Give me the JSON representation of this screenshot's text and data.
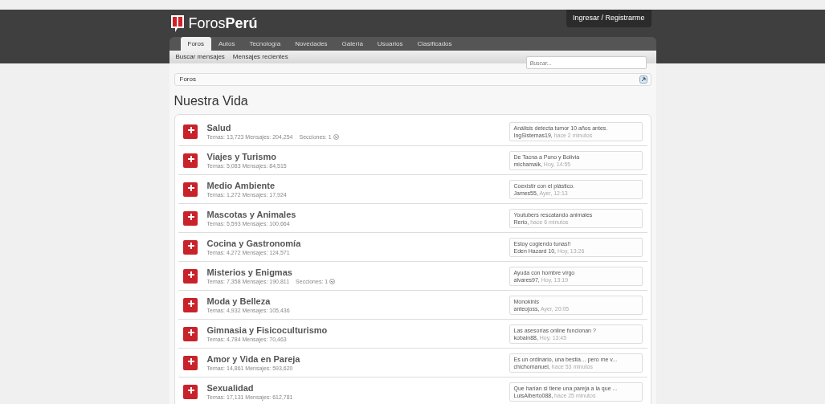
{
  "header": {
    "logo_light": "Foros",
    "logo_bold": "Perú",
    "login": "Ingresar / Registrarme"
  },
  "tabs": [
    {
      "label": "Foros",
      "selected": true
    },
    {
      "label": "Autos",
      "selected": false
    },
    {
      "label": "Tecnología",
      "selected": false
    },
    {
      "label": "Novedades",
      "selected": false
    },
    {
      "label": "Galería",
      "selected": false
    },
    {
      "label": "Usuarios",
      "selected": false
    },
    {
      "label": "Clasificados",
      "selected": false
    }
  ],
  "subnav": [
    "Buscar mensajes",
    "Mensajes recientes"
  ],
  "search": {
    "placeholder": "Buscar..."
  },
  "breadcrumb": [
    "Foros"
  ],
  "title": "Nuestra Vida",
  "forums": [
    {
      "name": "Salud",
      "stats": "Temas: 13,723 Mensajes: 204,254",
      "sections": "Secciones: 1",
      "last_title": "Análisis detecta tumor 10 años antes.",
      "last_user": "IngSistemas19,",
      "last_time": "hace 2 minutos"
    },
    {
      "name": "Viajes y Turismo",
      "stats": "Temas: 5,083 Mensajes: 84,515",
      "last_title": "De Tacna a Puno y Bolivia",
      "last_user": "michamaik,",
      "last_time": "Hoy, 14:55"
    },
    {
      "name": "Medio Ambiente",
      "stats": "Temas: 1,272 Mensajes: 17,924",
      "last_title": "Coexistir con el plástico.",
      "last_user": "James55,",
      "last_time": "Ayer, 12:13"
    },
    {
      "name": "Mascotas y Animales",
      "stats": "Temas: 5,593 Mensajes: 100,664",
      "last_title": "Youtubers rescatando animales",
      "last_user": "Rerio,",
      "last_time": "hace 6 minutos"
    },
    {
      "name": "Cocina y Gastronomía",
      "stats": "Temas: 4,272 Mensajes: 124,571",
      "last_title": "Estoy cogiendo tunas!!",
      "last_user": "Eden Hazard 10,",
      "last_time": "Hoy, 13:26"
    },
    {
      "name": "Misterios y Enigmas",
      "stats": "Temas: 7,358 Mensajes: 190,811",
      "sections": "Secciones: 1",
      "last_title": "Ayuda con hombre virgo",
      "last_user": "alvares97,",
      "last_time": "Hoy, 13:19"
    },
    {
      "name": "Moda y Belleza",
      "stats": "Temas: 4,932 Mensajes: 105,436",
      "last_title": "Monokinis",
      "last_user": "anteojoss,",
      "last_time": "Ayer, 20:05"
    },
    {
      "name": "Gimnasia y Fisicoculturismo",
      "stats": "Temas: 4,784 Mensajes: 70,463",
      "last_title": "Las asesorías online funcionan ?",
      "last_user": "kobain88,",
      "last_time": "Hoy, 13:45"
    },
    {
      "name": "Amor y Vida en Pareja",
      "stats": "Temas: 14,861 Mensajes: 593,620",
      "last_title": "Es un ordinario, una bestia… pero me v...",
      "last_user": "chichomanuel,",
      "last_time": "hace 53 minutos"
    },
    {
      "name": "Sexualidad",
      "stats": "Temas: 17,131 Mensajes: 612,781",
      "last_title": "Que harían si tiene una pareja a la que ...",
      "last_user": "LuisAlberto088,",
      "last_time": "hace 25 minutos"
    }
  ]
}
